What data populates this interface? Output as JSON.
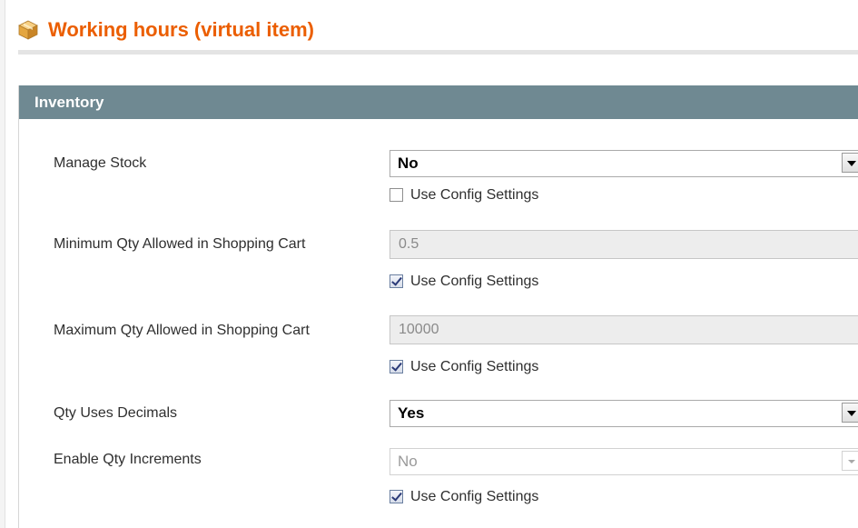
{
  "page": {
    "title": "Working hours (virtual item)",
    "title_icon": "package-box-icon"
  },
  "fieldset": {
    "title": "Inventory"
  },
  "fields": {
    "manage_stock": {
      "label": "Manage Stock",
      "value": "No",
      "use_config": {
        "label": "Use Config Settings",
        "checked": false
      }
    },
    "min_qty": {
      "label": "Minimum Qty Allowed in Shopping Cart",
      "value": "0.5",
      "disabled": true,
      "use_config": {
        "label": "Use Config Settings",
        "checked": true
      }
    },
    "max_qty": {
      "label": "Maximum Qty Allowed in Shopping Cart",
      "value": "10000",
      "disabled": true,
      "use_config": {
        "label": "Use Config Settings",
        "checked": true
      }
    },
    "qty_decimals": {
      "label": "Qty Uses Decimals",
      "value": "Yes"
    },
    "qty_increments": {
      "label": "Enable Qty Increments",
      "value": "No",
      "disabled": true,
      "use_config": {
        "label": "Use Config Settings",
        "checked": true
      }
    }
  },
  "colors": {
    "title": "#eb5e00",
    "fieldset_header": "#6f8992",
    "disabled_input_bg": "#ededed"
  }
}
